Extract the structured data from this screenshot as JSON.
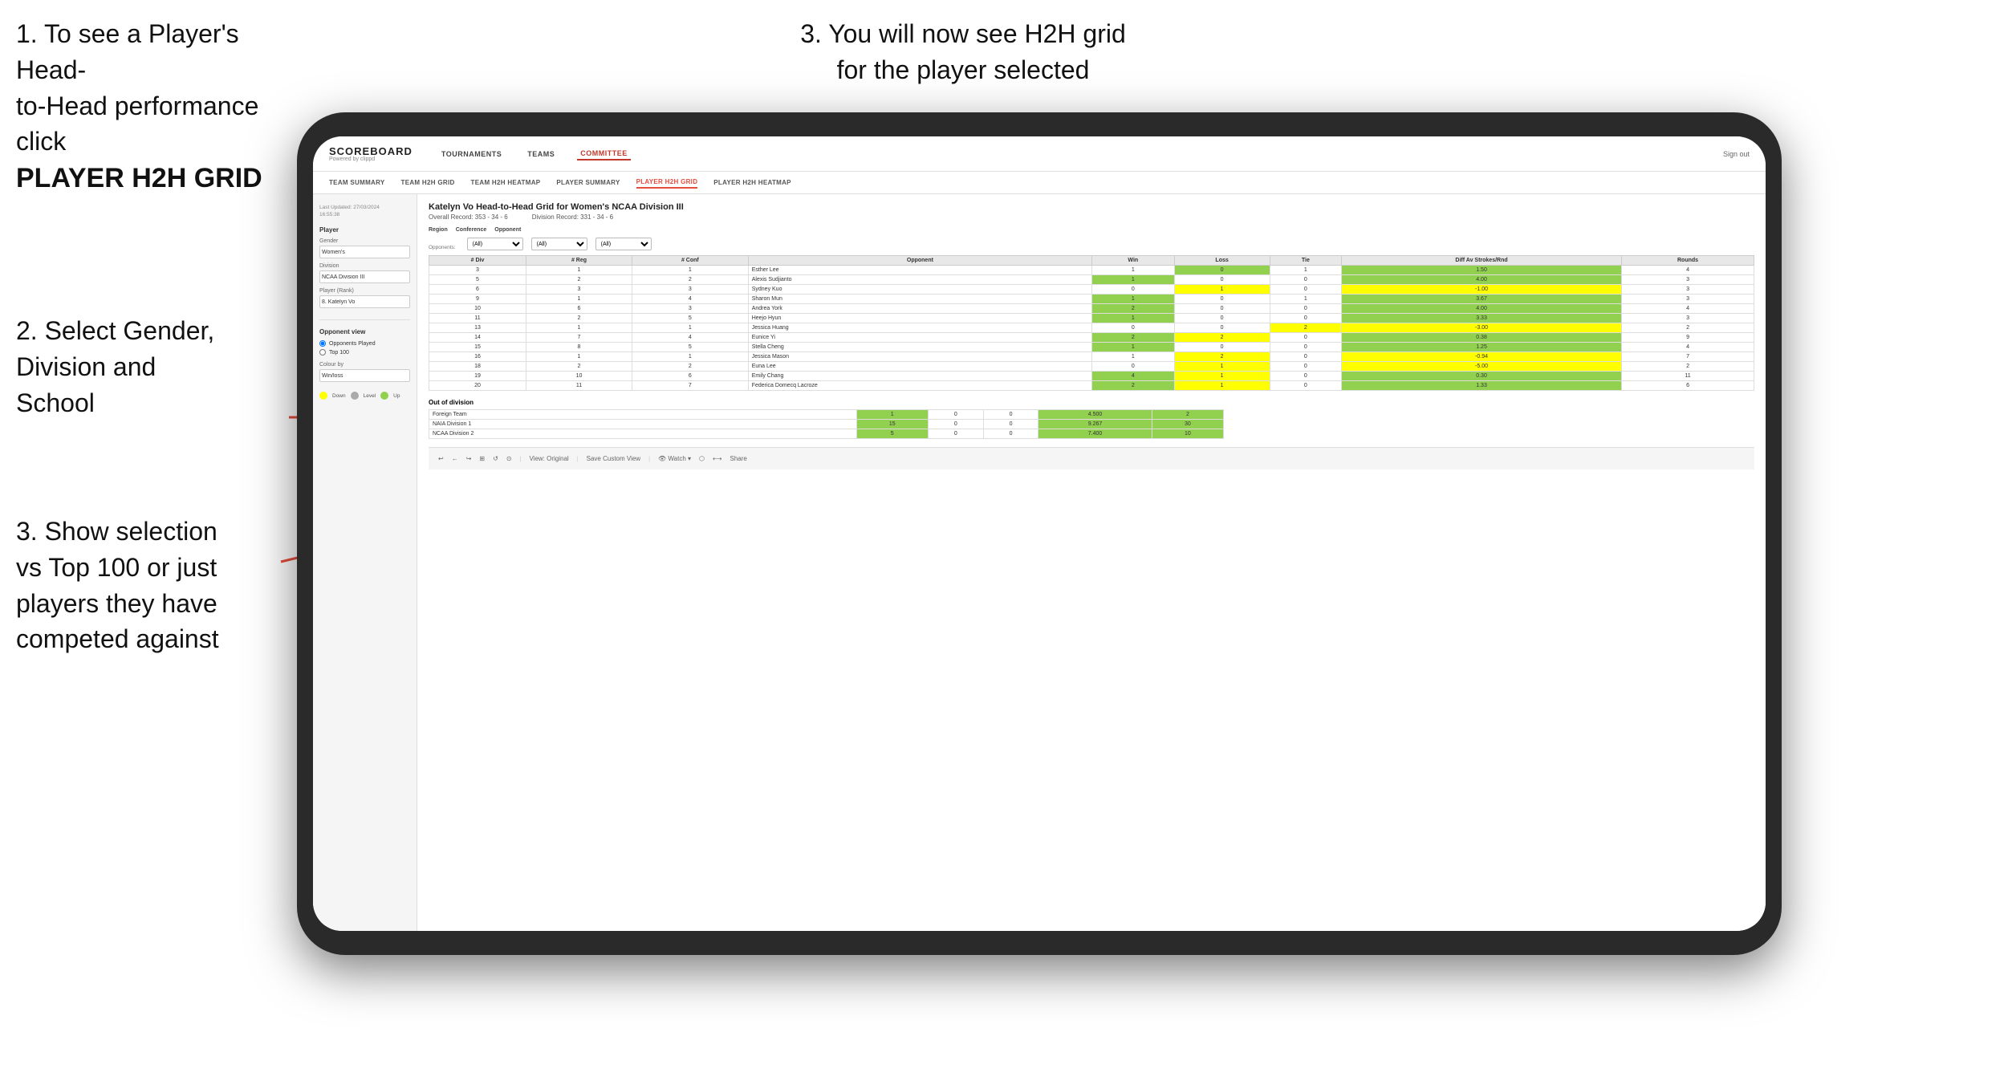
{
  "instructions": {
    "top_left_line1": "1. To see a Player's Head-",
    "top_left_line2": "to-Head performance click",
    "top_left_bold": "PLAYER H2H GRID",
    "top_right": "3. You will now see H2H grid\nfor the player selected",
    "mid_left_line1": "2. Select Gender,",
    "mid_left_line2": "Division and",
    "mid_left_line3": "School",
    "bot_left_line1": "3. Show selection",
    "bot_left_line2": "vs Top 100 or just",
    "bot_left_line3": "players they have",
    "bot_left_line4": "competed against"
  },
  "navbar": {
    "logo": "SCOREBOARD",
    "logo_sub": "Powered by clippd",
    "nav_items": [
      "TOURNAMENTS",
      "TEAMS",
      "COMMITTEE"
    ],
    "sign_out": "Sign out"
  },
  "sub_navbar": {
    "items": [
      "TEAM SUMMARY",
      "TEAM H2H GRID",
      "TEAM H2H HEATMAP",
      "PLAYER SUMMARY",
      "PLAYER H2H GRID",
      "PLAYER H2H HEATMAP"
    ],
    "active": "PLAYER H2H GRID"
  },
  "sidebar": {
    "meta": "Last Updated: 27/03/2024\n16:55:38",
    "player_section": "Player",
    "gender_label": "Gender",
    "gender_value": "Women's",
    "division_label": "Division",
    "division_value": "NCAA Division III",
    "player_rank_label": "Player (Rank)",
    "player_rank_value": "8. Katelyn Vo",
    "opponent_view_label": "Opponent view",
    "radio_opponents": "Opponents Played",
    "radio_top100": "Top 100",
    "colour_by_label": "Colour by",
    "colour_by_value": "Win/loss",
    "legend": [
      {
        "color": "#ffff00",
        "label": "Down"
      },
      {
        "color": "#aaaaaa",
        "label": "Level"
      },
      {
        "color": "#92d050",
        "label": "Up"
      }
    ]
  },
  "grid": {
    "title": "Katelyn Vo Head-to-Head Grid for Women's NCAA Division III",
    "overall_record": "Overall Record: 353 - 34 - 6",
    "division_record": "Division Record: 331 - 34 - 6",
    "filters": {
      "region_label": "Region",
      "conference_label": "Conference",
      "opponent_label": "Opponent",
      "opponents_label": "Opponents:",
      "region_value": "(All)",
      "conference_value": "(All)",
      "opponent_value": "(All)"
    },
    "table_headers": [
      "# Div",
      "# Reg",
      "# Conf",
      "Opponent",
      "Win",
      "Loss",
      "Tie",
      "Diff Av Strokes/Rnd",
      "Rounds"
    ],
    "rows": [
      {
        "div": "3",
        "reg": "1",
        "conf": "1",
        "opponent": "Esther Lee",
        "win": "1",
        "loss": "0",
        "tie": "1",
        "diff": "1.50",
        "rounds": "4",
        "win_color": "white",
        "loss_color": "green",
        "tie_color": "white"
      },
      {
        "div": "5",
        "reg": "2",
        "conf": "2",
        "opponent": "Alexis Sudjianto",
        "win": "1",
        "loss": "0",
        "tie": "0",
        "diff": "4.00",
        "rounds": "3",
        "win_color": "green",
        "loss_color": "white",
        "tie_color": "white"
      },
      {
        "div": "6",
        "reg": "3",
        "conf": "3",
        "opponent": "Sydney Kuo",
        "win": "0",
        "loss": "1",
        "tie": "0",
        "diff": "-1.00",
        "rounds": "3",
        "win_color": "white",
        "loss_color": "yellow",
        "tie_color": "white"
      },
      {
        "div": "9",
        "reg": "1",
        "conf": "4",
        "opponent": "Sharon Mun",
        "win": "1",
        "loss": "0",
        "tie": "1",
        "diff": "3.67",
        "rounds": "3",
        "win_color": "green",
        "loss_color": "white",
        "tie_color": "white"
      },
      {
        "div": "10",
        "reg": "6",
        "conf": "3",
        "opponent": "Andrea York",
        "win": "2",
        "loss": "0",
        "tie": "0",
        "diff": "4.00",
        "rounds": "4",
        "win_color": "green",
        "loss_color": "white",
        "tie_color": "white"
      },
      {
        "div": "11",
        "reg": "2",
        "conf": "5",
        "opponent": "Heejo Hyun",
        "win": "1",
        "loss": "0",
        "tie": "0",
        "diff": "3.33",
        "rounds": "3",
        "win_color": "green",
        "loss_color": "white",
        "tie_color": "white"
      },
      {
        "div": "13",
        "reg": "1",
        "conf": "1",
        "opponent": "Jessica Huang",
        "win": "0",
        "loss": "0",
        "tie": "2",
        "diff": "-3.00",
        "rounds": "2",
        "win_color": "white",
        "loss_color": "white",
        "tie_color": "yellow"
      },
      {
        "div": "14",
        "reg": "7",
        "conf": "4",
        "opponent": "Eunice Yi",
        "win": "2",
        "loss": "2",
        "tie": "0",
        "diff": "0.38",
        "rounds": "9",
        "win_color": "green",
        "loss_color": "yellow",
        "tie_color": "white"
      },
      {
        "div": "15",
        "reg": "8",
        "conf": "5",
        "opponent": "Stella Cheng",
        "win": "1",
        "loss": "0",
        "tie": "0",
        "diff": "1.25",
        "rounds": "4",
        "win_color": "green",
        "loss_color": "white",
        "tie_color": "white"
      },
      {
        "div": "16",
        "reg": "1",
        "conf": "1",
        "opponent": "Jessica Mason",
        "win": "1",
        "loss": "2",
        "tie": "0",
        "diff": "-0.94",
        "rounds": "7",
        "win_color": "white",
        "loss_color": "yellow",
        "tie_color": "white"
      },
      {
        "div": "18",
        "reg": "2",
        "conf": "2",
        "opponent": "Euna Lee",
        "win": "0",
        "loss": "1",
        "tie": "0",
        "diff": "-5.00",
        "rounds": "2",
        "win_color": "white",
        "loss_color": "yellow",
        "tie_color": "white"
      },
      {
        "div": "19",
        "reg": "10",
        "conf": "6",
        "opponent": "Emily Chang",
        "win": "4",
        "loss": "1",
        "tie": "0",
        "diff": "0.30",
        "rounds": "11",
        "win_color": "green",
        "loss_color": "yellow",
        "tie_color": "white"
      },
      {
        "div": "20",
        "reg": "11",
        "conf": "7",
        "opponent": "Federica Domecq Lacroze",
        "win": "2",
        "loss": "1",
        "tie": "0",
        "diff": "1.33",
        "rounds": "6",
        "win_color": "green",
        "loss_color": "yellow",
        "tie_color": "white"
      }
    ],
    "out_of_division_label": "Out of division",
    "out_of_division_rows": [
      {
        "label": "Foreign Team",
        "win": "1",
        "loss": "0",
        "tie": "0",
        "diff": "4.500",
        "rounds": "2"
      },
      {
        "label": "NAIA Division 1",
        "win": "15",
        "loss": "0",
        "tie": "0",
        "diff": "9.267",
        "rounds": "30"
      },
      {
        "label": "NCAA Division 2",
        "win": "5",
        "loss": "0",
        "tie": "0",
        "diff": "7.400",
        "rounds": "10"
      }
    ]
  },
  "toolbar": {
    "buttons": [
      "↩",
      "←",
      "↪",
      "⊞",
      "↺",
      "⊙",
      "View: Original",
      "Save Custom View",
      "👁 Watch ▾",
      "⬡",
      "⟷",
      "Share"
    ]
  }
}
